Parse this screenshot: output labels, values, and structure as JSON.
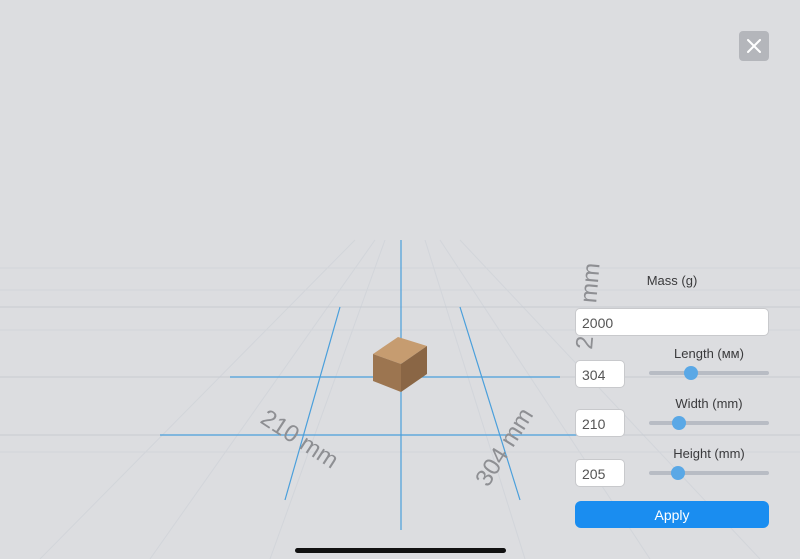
{
  "scene": {
    "dim_labels": {
      "width": "210 mm",
      "length": "304 mm",
      "height": "205 mm"
    }
  },
  "close_icon": "close-icon",
  "panel": {
    "mass": {
      "label": "Mass (g)",
      "value": "2000"
    },
    "length": {
      "label": "Length (мм)",
      "value": "304",
      "slider_fraction": 0.35
    },
    "width": {
      "label": "Width (mm)",
      "value": "210",
      "slider_fraction": 0.25
    },
    "height": {
      "label": "Height (mm)",
      "value": "205",
      "slider_fraction": 0.24
    },
    "apply_label": "Apply"
  },
  "colors": {
    "accent": "#1a8df0",
    "slider_thumb": "#5aa8e6",
    "box": "#a6805a",
    "highlight_grid": "#4a9fdb"
  }
}
